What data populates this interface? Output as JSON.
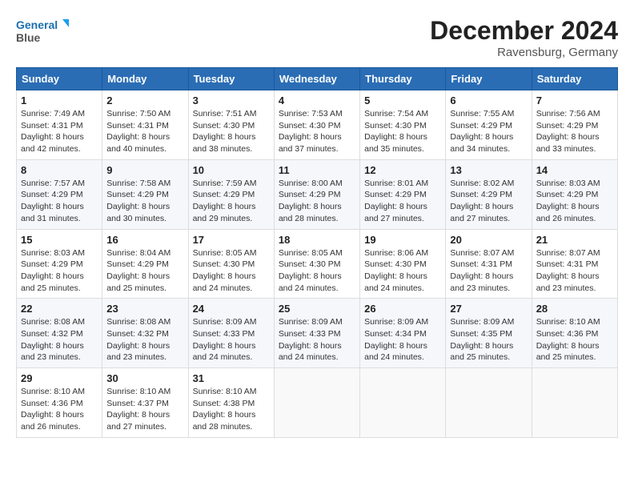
{
  "header": {
    "logo_line1": "General",
    "logo_line2": "Blue",
    "month_year": "December 2024",
    "location": "Ravensburg, Germany"
  },
  "weekdays": [
    "Sunday",
    "Monday",
    "Tuesday",
    "Wednesday",
    "Thursday",
    "Friday",
    "Saturday"
  ],
  "weeks": [
    [
      {
        "day": "1",
        "sunrise": "Sunrise: 7:49 AM",
        "sunset": "Sunset: 4:31 PM",
        "daylight": "Daylight: 8 hours and 42 minutes."
      },
      {
        "day": "2",
        "sunrise": "Sunrise: 7:50 AM",
        "sunset": "Sunset: 4:31 PM",
        "daylight": "Daylight: 8 hours and 40 minutes."
      },
      {
        "day": "3",
        "sunrise": "Sunrise: 7:51 AM",
        "sunset": "Sunset: 4:30 PM",
        "daylight": "Daylight: 8 hours and 38 minutes."
      },
      {
        "day": "4",
        "sunrise": "Sunrise: 7:53 AM",
        "sunset": "Sunset: 4:30 PM",
        "daylight": "Daylight: 8 hours and 37 minutes."
      },
      {
        "day": "5",
        "sunrise": "Sunrise: 7:54 AM",
        "sunset": "Sunset: 4:30 PM",
        "daylight": "Daylight: 8 hours and 35 minutes."
      },
      {
        "day": "6",
        "sunrise": "Sunrise: 7:55 AM",
        "sunset": "Sunset: 4:29 PM",
        "daylight": "Daylight: 8 hours and 34 minutes."
      },
      {
        "day": "7",
        "sunrise": "Sunrise: 7:56 AM",
        "sunset": "Sunset: 4:29 PM",
        "daylight": "Daylight: 8 hours and 33 minutes."
      }
    ],
    [
      {
        "day": "8",
        "sunrise": "Sunrise: 7:57 AM",
        "sunset": "Sunset: 4:29 PM",
        "daylight": "Daylight: 8 hours and 31 minutes."
      },
      {
        "day": "9",
        "sunrise": "Sunrise: 7:58 AM",
        "sunset": "Sunset: 4:29 PM",
        "daylight": "Daylight: 8 hours and 30 minutes."
      },
      {
        "day": "10",
        "sunrise": "Sunrise: 7:59 AM",
        "sunset": "Sunset: 4:29 PM",
        "daylight": "Daylight: 8 hours and 29 minutes."
      },
      {
        "day": "11",
        "sunrise": "Sunrise: 8:00 AM",
        "sunset": "Sunset: 4:29 PM",
        "daylight": "Daylight: 8 hours and 28 minutes."
      },
      {
        "day": "12",
        "sunrise": "Sunrise: 8:01 AM",
        "sunset": "Sunset: 4:29 PM",
        "daylight": "Daylight: 8 hours and 27 minutes."
      },
      {
        "day": "13",
        "sunrise": "Sunrise: 8:02 AM",
        "sunset": "Sunset: 4:29 PM",
        "daylight": "Daylight: 8 hours and 27 minutes."
      },
      {
        "day": "14",
        "sunrise": "Sunrise: 8:03 AM",
        "sunset": "Sunset: 4:29 PM",
        "daylight": "Daylight: 8 hours and 26 minutes."
      }
    ],
    [
      {
        "day": "15",
        "sunrise": "Sunrise: 8:03 AM",
        "sunset": "Sunset: 4:29 PM",
        "daylight": "Daylight: 8 hours and 25 minutes."
      },
      {
        "day": "16",
        "sunrise": "Sunrise: 8:04 AM",
        "sunset": "Sunset: 4:29 PM",
        "daylight": "Daylight: 8 hours and 25 minutes."
      },
      {
        "day": "17",
        "sunrise": "Sunrise: 8:05 AM",
        "sunset": "Sunset: 4:30 PM",
        "daylight": "Daylight: 8 hours and 24 minutes."
      },
      {
        "day": "18",
        "sunrise": "Sunrise: 8:05 AM",
        "sunset": "Sunset: 4:30 PM",
        "daylight": "Daylight: 8 hours and 24 minutes."
      },
      {
        "day": "19",
        "sunrise": "Sunrise: 8:06 AM",
        "sunset": "Sunset: 4:30 PM",
        "daylight": "Daylight: 8 hours and 24 minutes."
      },
      {
        "day": "20",
        "sunrise": "Sunrise: 8:07 AM",
        "sunset": "Sunset: 4:31 PM",
        "daylight": "Daylight: 8 hours and 23 minutes."
      },
      {
        "day": "21",
        "sunrise": "Sunrise: 8:07 AM",
        "sunset": "Sunset: 4:31 PM",
        "daylight": "Daylight: 8 hours and 23 minutes."
      }
    ],
    [
      {
        "day": "22",
        "sunrise": "Sunrise: 8:08 AM",
        "sunset": "Sunset: 4:32 PM",
        "daylight": "Daylight: 8 hours and 23 minutes."
      },
      {
        "day": "23",
        "sunrise": "Sunrise: 8:08 AM",
        "sunset": "Sunset: 4:32 PM",
        "daylight": "Daylight: 8 hours and 23 minutes."
      },
      {
        "day": "24",
        "sunrise": "Sunrise: 8:09 AM",
        "sunset": "Sunset: 4:33 PM",
        "daylight": "Daylight: 8 hours and 24 minutes."
      },
      {
        "day": "25",
        "sunrise": "Sunrise: 8:09 AM",
        "sunset": "Sunset: 4:33 PM",
        "daylight": "Daylight: 8 hours and 24 minutes."
      },
      {
        "day": "26",
        "sunrise": "Sunrise: 8:09 AM",
        "sunset": "Sunset: 4:34 PM",
        "daylight": "Daylight: 8 hours and 24 minutes."
      },
      {
        "day": "27",
        "sunrise": "Sunrise: 8:09 AM",
        "sunset": "Sunset: 4:35 PM",
        "daylight": "Daylight: 8 hours and 25 minutes."
      },
      {
        "day": "28",
        "sunrise": "Sunrise: 8:10 AM",
        "sunset": "Sunset: 4:36 PM",
        "daylight": "Daylight: 8 hours and 25 minutes."
      }
    ],
    [
      {
        "day": "29",
        "sunrise": "Sunrise: 8:10 AM",
        "sunset": "Sunset: 4:36 PM",
        "daylight": "Daylight: 8 hours and 26 minutes."
      },
      {
        "day": "30",
        "sunrise": "Sunrise: 8:10 AM",
        "sunset": "Sunset: 4:37 PM",
        "daylight": "Daylight: 8 hours and 27 minutes."
      },
      {
        "day": "31",
        "sunrise": "Sunrise: 8:10 AM",
        "sunset": "Sunset: 4:38 PM",
        "daylight": "Daylight: 8 hours and 28 minutes."
      },
      null,
      null,
      null,
      null
    ]
  ]
}
